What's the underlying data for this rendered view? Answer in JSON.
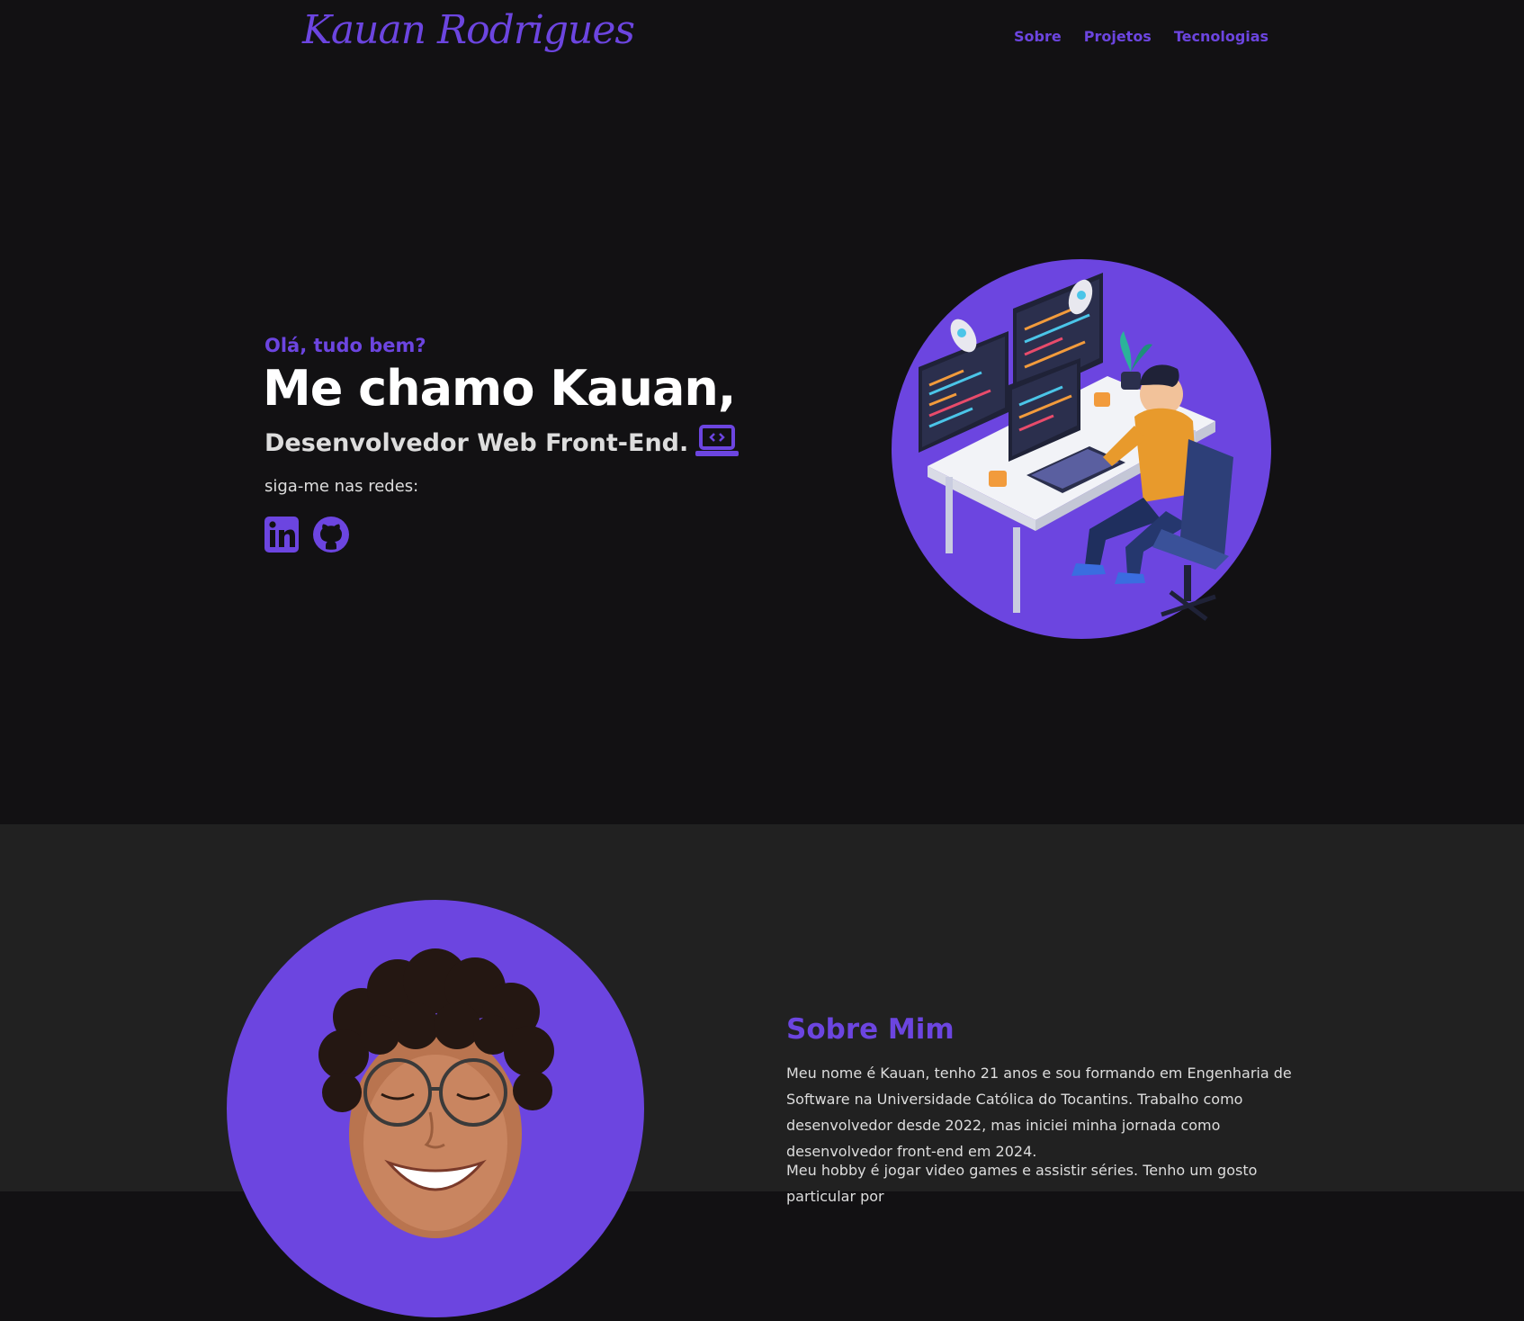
{
  "header": {
    "logo": "Kauan Rodrigues",
    "nav": [
      {
        "label": "Sobre"
      },
      {
        "label": "Projetos"
      },
      {
        "label": "Tecnologias"
      }
    ]
  },
  "hero": {
    "greeting": "Olá, tudo bem?",
    "title": "Me chamo Kauan,",
    "subtitle": "Desenvolvedor Web Front-End.",
    "follow_label": "siga-me nas redes:",
    "socials": [
      {
        "icon": "linkedin-icon"
      },
      {
        "icon": "github-icon"
      }
    ]
  },
  "about": {
    "title": "Sobre Mim",
    "paragraphs": [
      "Meu nome é Kauan, tenho 21 anos e sou formando em Engenharia de Software na Universidade Católica do Tocantins. Trabalho como desenvolvedor desde 2022, mas iniciei minha jornada como desenvolvedor front-end em 2024.",
      "Meu hobby é jogar video games e assistir séries. Tenho um gosto particular por"
    ]
  },
  "colors": {
    "accent": "#6c45e0",
    "background": "#121113",
    "section_bg": "#212121"
  }
}
